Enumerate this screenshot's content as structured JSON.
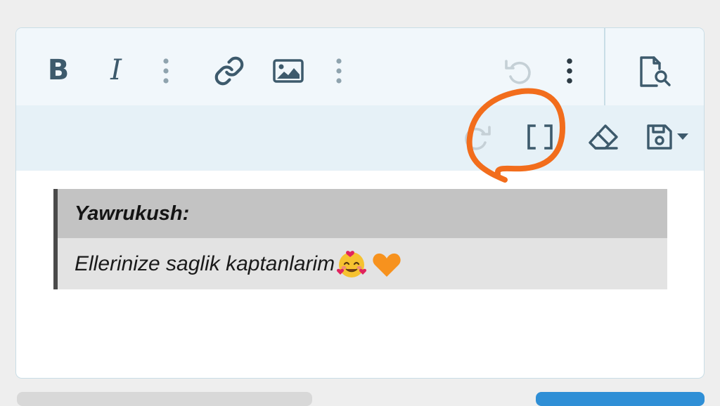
{
  "toolbar": {
    "bold_label": "B",
    "italic_label": "I",
    "row1_icons": [
      "bold-icon",
      "italic-icon",
      "more-vertical-icon",
      "link-icon",
      "image-icon",
      "more-vertical-icon",
      "undo-icon",
      "more-vertical-icon",
      "preview-icon"
    ],
    "row2_icons": [
      "redo-icon",
      "bbcode-brackets-icon",
      "eraser-icon",
      "save-draft-icon",
      "caret-down-icon"
    ],
    "bbcode_label": "[ ]"
  },
  "quote": {
    "author": "Yawrukush:",
    "text": "Ellerinize saglik kaptanlarim",
    "emojis": [
      "smiling-face-with-hearts-emoji",
      "orange-heart-emoji"
    ]
  },
  "colors": {
    "icon": "#3d5a6c",
    "toolbar_bg": "#f1f7fb",
    "toolbar_row2_bg": "#e6f1f7",
    "quote_header_bg": "#c3c3c3",
    "quote_body_bg": "#e3e3e3",
    "annotation": "#f26d1c",
    "heart": "#f7921e"
  }
}
